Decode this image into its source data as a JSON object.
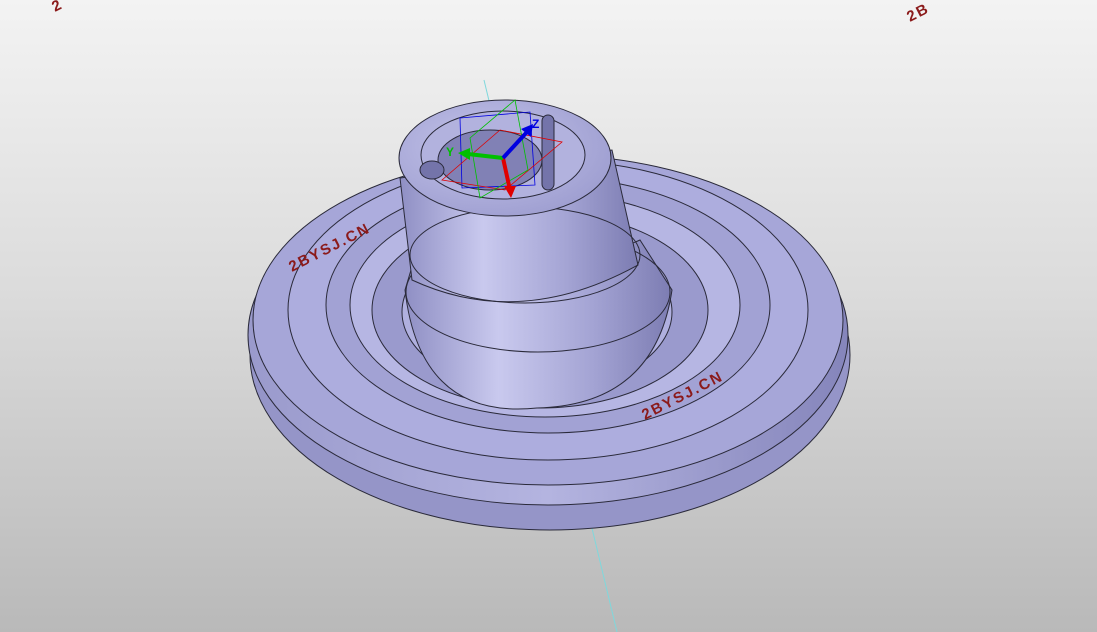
{
  "viewport": {
    "watermark_text": "2BYSJ.CN",
    "watermark_partial_left": "2",
    "watermark_partial_right": "2B",
    "background_top": "#f3f3f3",
    "background_bottom": "#b9b9b9",
    "watermark_color": "#8b1a1a"
  },
  "model": {
    "part_color": "#a8a8d6",
    "edge_color": "#2a2a3a",
    "axis_line_color": "#7fd8dc"
  },
  "triad": {
    "x_color": "#e00000",
    "y_color": "#00c000",
    "z_color": "#0000e0",
    "y_label": "Y",
    "z_label": "Z"
  }
}
